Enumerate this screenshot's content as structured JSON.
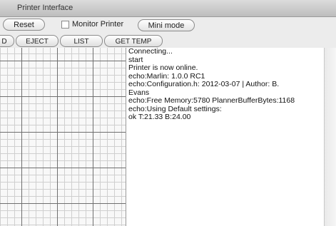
{
  "window": {
    "title": "Printer Interface"
  },
  "toolbar": {
    "reset_label": "Reset",
    "monitor_label": "Monitor Printer",
    "monitor_checked": false,
    "mini_label": "Mini mode"
  },
  "tabs": [
    {
      "label": "D"
    },
    {
      "label": "EJECT"
    },
    {
      "label": "LIST"
    },
    {
      "label": "GET TEMP"
    }
  ],
  "log": {
    "lines": [
      "Connecting...",
      "start",
      "Printer is now online.",
      "echo:Marlin: 1.0.0 RC1",
      "echo:Configuration.h: 2012-03-07 | Author: B.",
      "Evans",
      "echo:Free Memory:5780 PlannerBufferBytes:1168",
      "echo:Using Default settings:",
      "ok T:21.33 B:24.00"
    ]
  },
  "colors": {
    "titlebar": "#c9c9c9",
    "grid_major": "#6f6f6f",
    "grid_minor": "#cfcfcf"
  }
}
